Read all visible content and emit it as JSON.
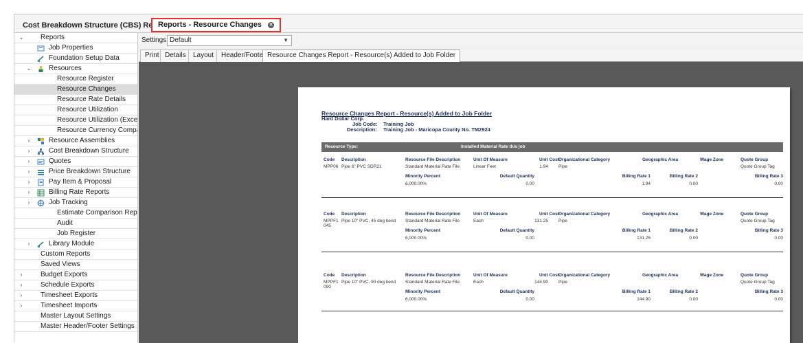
{
  "tabs": {
    "first": "Cost Breakdown Structure (CBS) Register",
    "active": "Reports - Resource Changes"
  },
  "sidebar": {
    "items": [
      {
        "label": "Reports",
        "level": 0,
        "arrow": "⌄"
      },
      {
        "label": "Job Properties",
        "level": 1,
        "icon": "job-properties-icon"
      },
      {
        "label": "Foundation Setup Data",
        "level": 1,
        "icon": "foundation-setup-icon"
      },
      {
        "label": "Resources",
        "level": 1,
        "arrow": "⌄",
        "icon": "resources-icon"
      },
      {
        "label": "Resource Register",
        "level": 2
      },
      {
        "label": "Resource Changes",
        "level": 2,
        "selected": true
      },
      {
        "label": "Resource Rate Details",
        "level": 2
      },
      {
        "label": "Resource Utilization",
        "level": 2
      },
      {
        "label": "Resource Utilization (Excel)",
        "level": 2
      },
      {
        "label": "Resource Currency Comparison",
        "level": 2
      },
      {
        "label": "Resource Assemblies",
        "level": 1,
        "arrow": "›",
        "icon": "resource-assemblies-icon"
      },
      {
        "label": "Cost Breakdown Structure",
        "level": 1,
        "arrow": "›",
        "icon": "cost-breakdown-icon"
      },
      {
        "label": "Quotes",
        "level": 1,
        "arrow": "›",
        "icon": "quotes-icon"
      },
      {
        "label": "Price Breakdown Structure",
        "level": 1,
        "arrow": "›",
        "icon": "price-breakdown-icon"
      },
      {
        "label": "Pay Item & Proposal",
        "level": 1,
        "arrow": "›",
        "icon": "pay-item-icon"
      },
      {
        "label": "Billing Rate Reports",
        "level": 1,
        "arrow": "›",
        "icon": "billing-rate-icon"
      },
      {
        "label": "Job Tracking",
        "level": 1,
        "arrow": "›",
        "icon": "job-tracking-icon"
      },
      {
        "label": "Estimate Comparison Report",
        "level": 2
      },
      {
        "label": "Audit",
        "level": 2
      },
      {
        "label": "Job Register",
        "level": 2
      },
      {
        "label": "Library Module",
        "level": 1,
        "arrow": "›",
        "icon": "library-module-icon"
      },
      {
        "label": "Custom Reports",
        "level": 0
      },
      {
        "label": "Saved Views",
        "level": 0
      },
      {
        "label": "Budget Exports",
        "level": 0,
        "arrow": "›"
      },
      {
        "label": "Schedule Exports",
        "level": 0,
        "arrow": "›"
      },
      {
        "label": "Timesheet Exports",
        "level": 0,
        "arrow": "›"
      },
      {
        "label": "Timesheet Imports",
        "level": 0,
        "arrow": "›"
      },
      {
        "label": "Master Layout Settings",
        "level": 0
      },
      {
        "label": "Master Header/Footer Settings",
        "level": 0
      }
    ]
  },
  "settings": {
    "label": "Settings:",
    "value": "Default"
  },
  "subtabs": [
    "Print",
    "Details",
    "Layout",
    "Header/Footer",
    "Resource Changes Report - Resource(s) Added to Job Folder"
  ],
  "report": {
    "title": "Resource Changes Report - Resource(s) Added to Job Folder",
    "company": "Hard Dollar Corp.",
    "job_code_label": "Job Code:",
    "job_code": "Training Job",
    "description_label": "Description:",
    "description": "Training Job - Maricopa County No. TM2924",
    "band_left": "Resource Type:",
    "band_right": "Installed Material Rate this job",
    "headers": {
      "code": "Code",
      "description": "Description",
      "rfd": "Resource File Description",
      "uom": "Unit Of Measure",
      "unit_cost": "Unit Cost",
      "org_cat": "Organizational Category",
      "geo": "Geographic Area",
      "wage": "Wage Zone",
      "quote": "Quote Group",
      "minority": "Minority Percent",
      "default_qty": "Default Quantity",
      "br1": "Billing Rate 1",
      "br2": "Billing Rate 2",
      "br3": "Billing Rate 3"
    },
    "records": [
      {
        "code": "MPP06",
        "code2": "",
        "description": "Pipe 6\" PVC SDR21",
        "rfd": "Standard Material Rate File",
        "uom": "Linear Feet",
        "unit_cost": "1.94",
        "org_cat": "Pipe",
        "quote": "Quote Group Tag",
        "minority": "6,000.00%",
        "default_qty": "0.00",
        "br1": "1.94",
        "br2": "0.00",
        "br3": "0.00"
      },
      {
        "code": "MPPF1",
        "code2": "045",
        "description": "Pipe 10\" PVC, 45 deg bend",
        "rfd": "Standard Material Rate File",
        "uom": "Each",
        "unit_cost": "131.25",
        "org_cat": "Pipe",
        "quote": "Quote Group Tag",
        "minority": "6,000.00%",
        "default_qty": "0.00",
        "br1": "131.25",
        "br2": "0.00",
        "br3": "0.00"
      },
      {
        "code": "MPPF1",
        "code2": "090",
        "description": "Pipe 10\" PVC, 90 deg bend",
        "rfd": "Standard Material Rate File",
        "uom": "Each",
        "unit_cost": "144.90",
        "org_cat": "Pipe",
        "quote": "Quote Group Tag",
        "minority": "6,000.00%",
        "default_qty": "0.00",
        "br1": "144.90",
        "br2": "0.00",
        "br3": "0.00"
      }
    ]
  }
}
